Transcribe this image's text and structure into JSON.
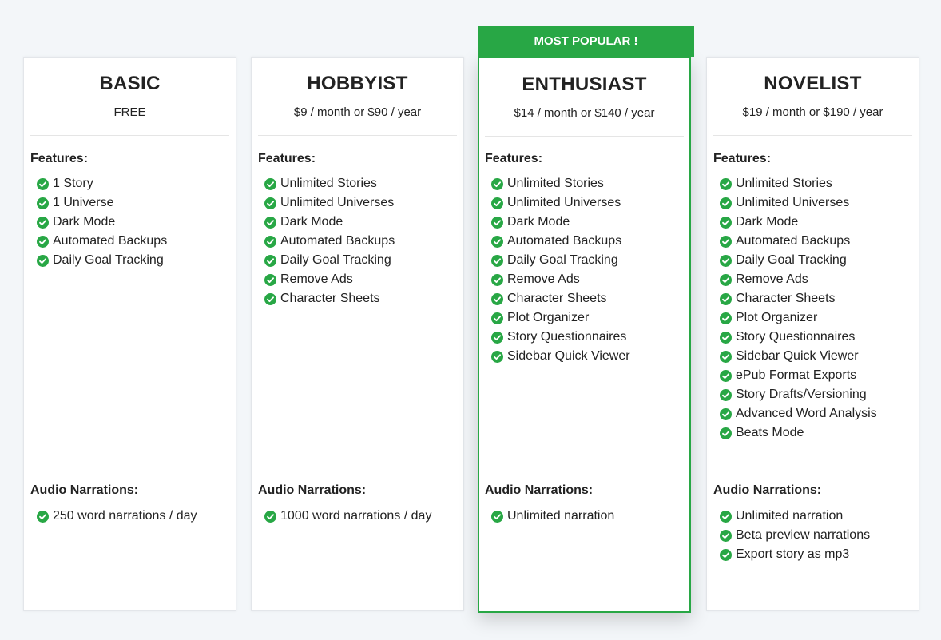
{
  "ribbon": "MOST POPULAR !",
  "colors": {
    "accent": "#28a745",
    "background": "#f3f6f9"
  },
  "icons": {
    "check": "check-circle-icon"
  },
  "plans": [
    {
      "name": "BASIC",
      "price": "FREE",
      "features_title": "Features:",
      "features": [
        "1 Story",
        "1 Universe",
        "Dark Mode",
        "Automated Backups",
        "Daily Goal Tracking"
      ],
      "audio_title": "Audio Narrations:",
      "audio": [
        "250 word narrations / day"
      ]
    },
    {
      "name": "HOBBYIST",
      "price": "$9 / month or $90 / year",
      "features_title": "Features:",
      "features": [
        "Unlimited Stories",
        "Unlimited Universes",
        "Dark Mode",
        "Automated Backups",
        "Daily Goal Tracking",
        "Remove Ads",
        "Character Sheets"
      ],
      "audio_title": "Audio Narrations:",
      "audio": [
        "1000 word narrations / day"
      ]
    },
    {
      "name": "ENTHUSIAST",
      "price": "$14 / month or $140 / year",
      "features_title": "Features:",
      "features": [
        "Unlimited Stories",
        "Unlimited Universes",
        "Dark Mode",
        "Automated Backups",
        "Daily Goal Tracking",
        "Remove Ads",
        "Character Sheets",
        "Plot Organizer",
        "Story Questionnaires",
        "Sidebar Quick Viewer"
      ],
      "audio_title": "Audio Narrations:",
      "audio": [
        "Unlimited narration"
      ]
    },
    {
      "name": "NOVELIST",
      "price": "$19 / month or $190 / year",
      "features_title": "Features:",
      "features": [
        "Unlimited Stories",
        "Unlimited Universes",
        "Dark Mode",
        "Automated Backups",
        "Daily Goal Tracking",
        "Remove Ads",
        "Character Sheets",
        "Plot Organizer",
        "Story Questionnaires",
        "Sidebar Quick Viewer",
        "ePub Format Exports",
        "Story Drafts/Versioning",
        "Advanced Word Analysis",
        "Beats Mode"
      ],
      "audio_title": "Audio Narrations:",
      "audio": [
        "Unlimited narration",
        "Beta preview narrations",
        "Export story as mp3"
      ]
    }
  ]
}
